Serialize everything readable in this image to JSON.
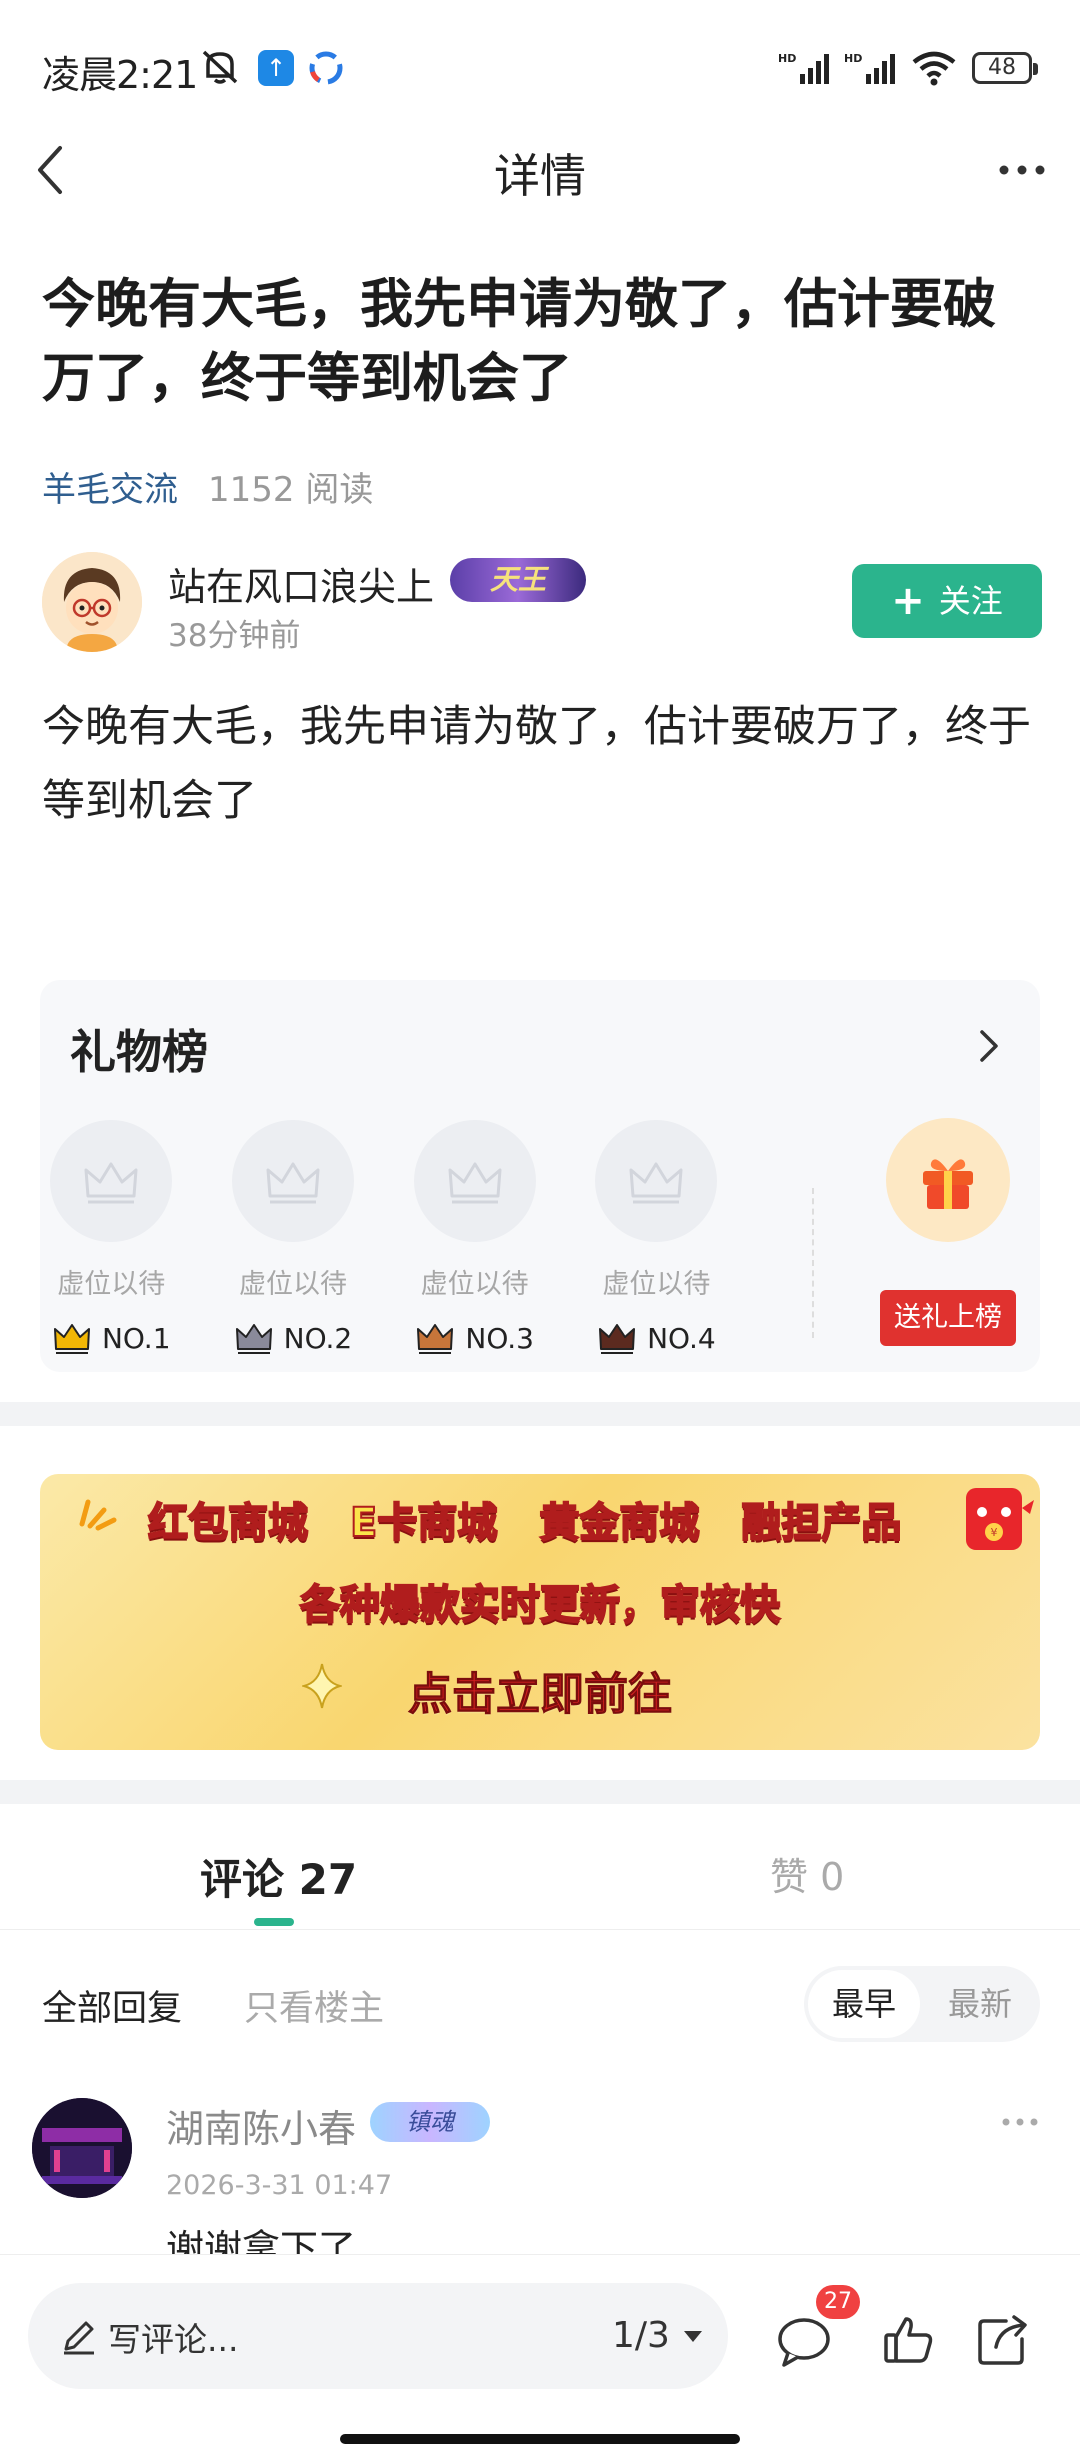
{
  "status_bar": {
    "time": "凌晨2:21",
    "battery": "48"
  },
  "nav": {
    "title": "详情"
  },
  "post": {
    "title": "今晚有大毛，我先申请为敬了，估计要破万了，终于等到机会了",
    "category": "羊毛交流",
    "read_count": "1152 阅读",
    "body": "今晚有大毛，我先申请为敬了，估计要破万了，终于等到机会了"
  },
  "author": {
    "name": "站在风口浪尖上",
    "badge": "天王",
    "time": "38分钟前",
    "follow_label": "关注"
  },
  "gift_board": {
    "title": "礼物榜",
    "slots": [
      {
        "label": "虚位以待",
        "rank": "NO.1",
        "crown_color": "#f2b705"
      },
      {
        "label": "虚位以待",
        "rank": "NO.2",
        "crown_color": "#8a8a9a"
      },
      {
        "label": "虚位以待",
        "rank": "NO.3",
        "crown_color": "#c7753a"
      },
      {
        "label": "虚位以待",
        "rank": "NO.4",
        "crown_color": "#5c2a1f"
      }
    ],
    "send_label": "送礼上榜"
  },
  "banner": {
    "items": [
      "红包商城",
      "E卡商城",
      "黄金商城",
      "融担产品"
    ],
    "subtitle": "各种爆款实时更新，审核快",
    "cta": "点击立即前往"
  },
  "tabs": {
    "comments_label": "评论 27",
    "likes_label": "赞 0"
  },
  "filters": {
    "all": "全部回复",
    "op_only": "只看楼主",
    "earliest": "最早",
    "latest": "最新"
  },
  "comment": {
    "name": "湖南陈小春",
    "badge": "镇魂",
    "time": "2026-3-31 01:47",
    "text": "谢谢拿下了"
  },
  "bottom_bar": {
    "placeholder": "写评论...",
    "page": "1/3",
    "comment_count": "27"
  },
  "colors": {
    "accent": "#2bb48d",
    "category": "#2f5e8f",
    "gift_button": "#e0322f"
  }
}
